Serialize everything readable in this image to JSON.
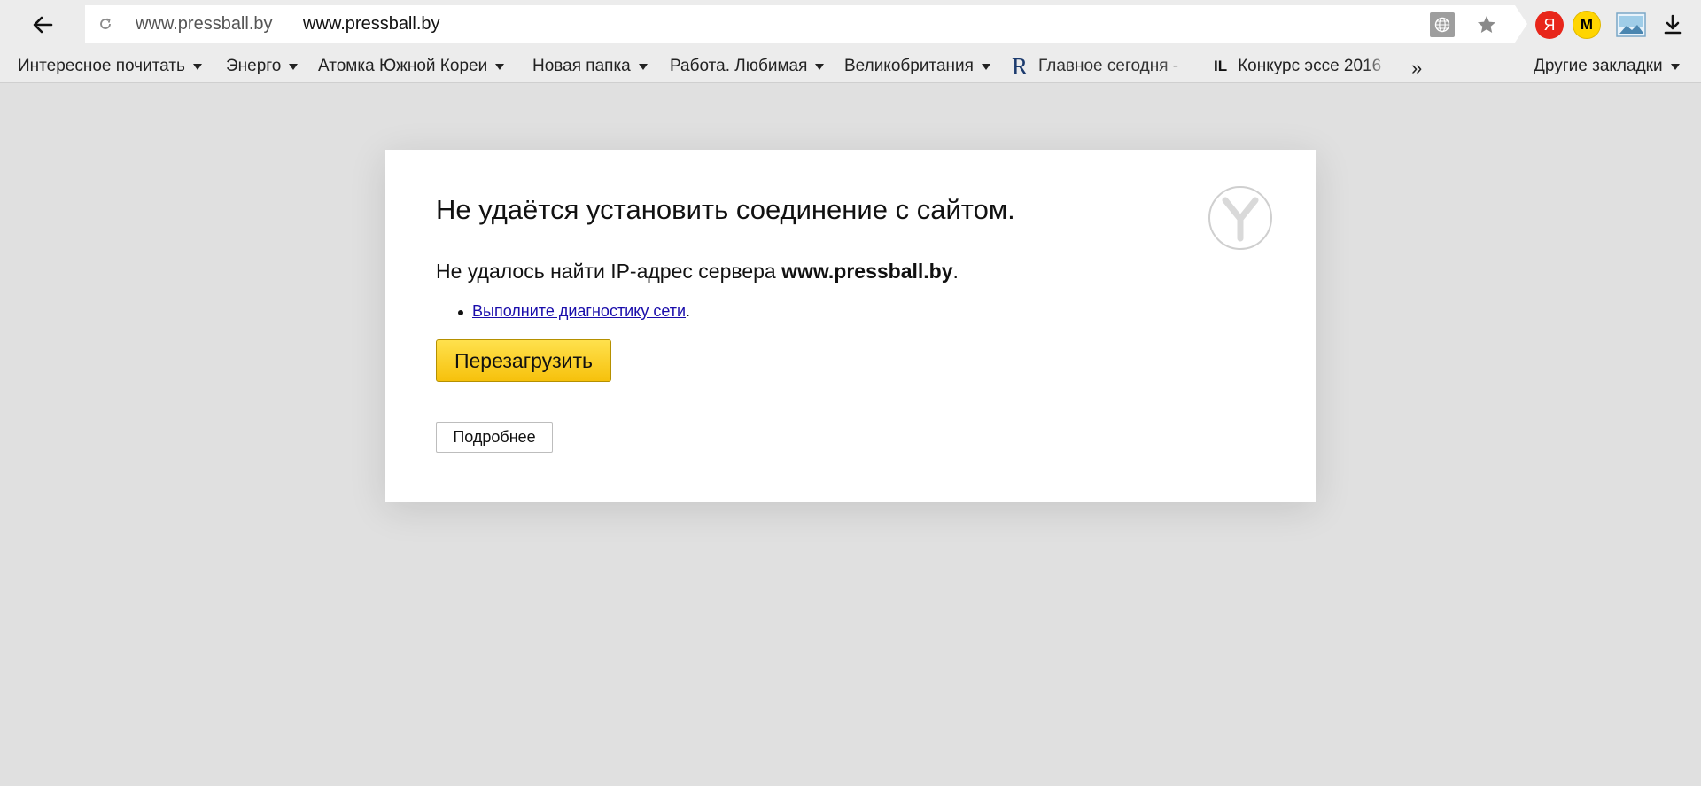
{
  "toolbar": {
    "url_host": "www.pressball.by",
    "url_full": "www.pressball.by",
    "icons": [
      "back-arrow-icon",
      "reload-icon",
      "translate-icon",
      "star-icon",
      "download-icon"
    ],
    "extensions": {
      "yandex_label": "Я",
      "mail_label": "M"
    }
  },
  "bookmarks": {
    "items": [
      {
        "label": "Интересное почитать",
        "folder": true
      },
      {
        "label": "Энерго",
        "folder": true
      },
      {
        "label": "Атомка Южной Кореи",
        "folder": true
      },
      {
        "label": "Новая папка",
        "folder": true
      },
      {
        "label": "Работа. Любимая",
        "folder": true
      },
      {
        "label": "Великобритания",
        "folder": true
      },
      {
        "label": "Главное сегодня -",
        "folder": false,
        "favicon": "R"
      },
      {
        "label": "Конкурс эссе 2016",
        "folder": false,
        "favicon": "IL"
      }
    ],
    "overflow": "»",
    "other_label": "Другие закладки"
  },
  "error": {
    "title": "Не удаётся установить соединение с сайтом.",
    "message_prefix": "Не удалось найти IP-адрес сервера ",
    "message_host": "www.pressball.by",
    "message_suffix": ".",
    "diagnostic_link": "Выполните диагностику сети",
    "diagnostic_suffix": ".",
    "reload_button": "Перезагрузить",
    "details_button": "Подробнее"
  },
  "colors": {
    "page_bg": "#e0e0e0",
    "toolbar_bg": "#ececec",
    "reload_button": "#f6c10c",
    "link": "#1a0dab",
    "yandex_red": "#e8261a",
    "mail_yellow": "#ffd500"
  }
}
